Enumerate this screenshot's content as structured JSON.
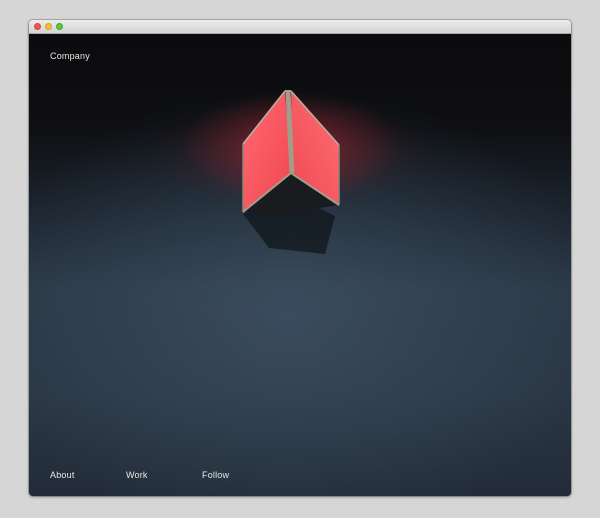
{
  "window": {
    "controls": [
      "close",
      "minimize",
      "zoom"
    ]
  },
  "header": {
    "brand": "Company"
  },
  "hero": {
    "image": "red-cube-lamp-on-dark-wall",
    "accent_color": "#ff5a64",
    "background_color": "#2b3846"
  },
  "footer_nav": {
    "items": [
      {
        "label": "About"
      },
      {
        "label": "Work"
      },
      {
        "label": "Follow"
      }
    ]
  }
}
